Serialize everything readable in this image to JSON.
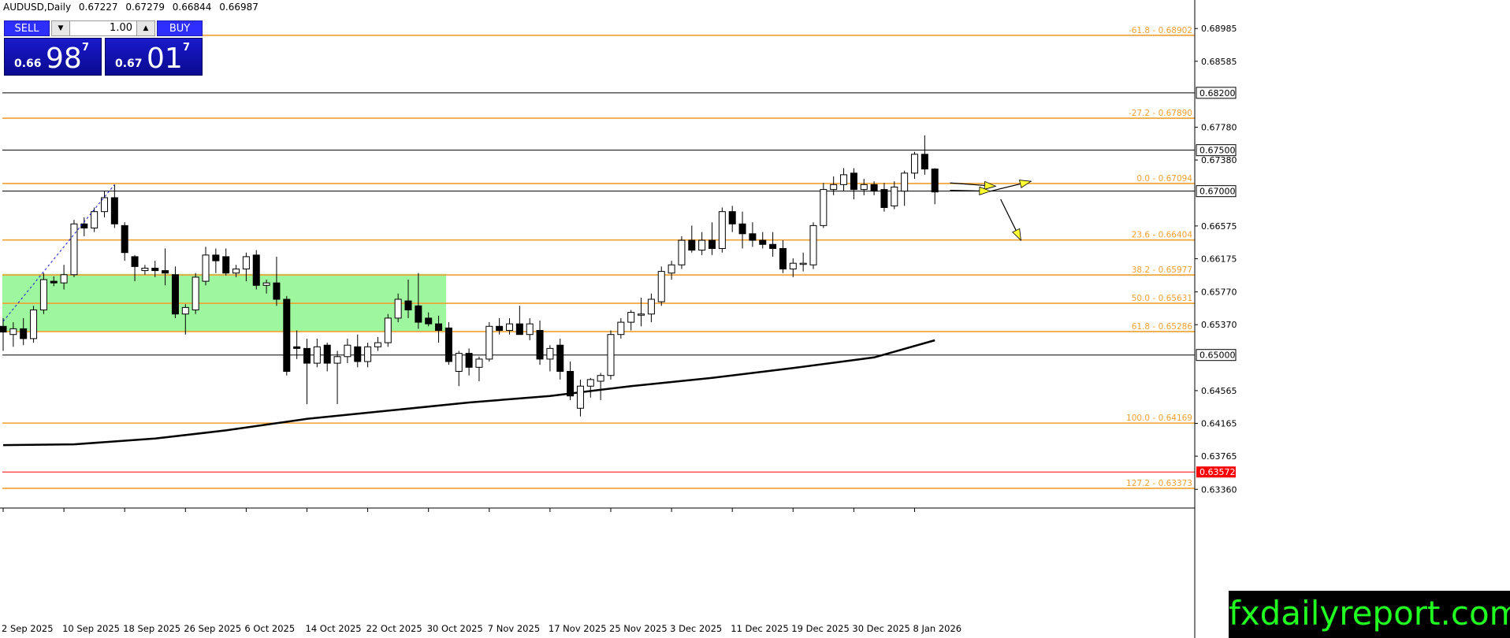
{
  "header": {
    "symbol": "AUDUSD,Daily",
    "open": "0.67227",
    "high": "0.67279",
    "low": "0.66844",
    "close": "0.66987"
  },
  "trade_panel": {
    "sell_label": "SELL",
    "buy_label": "BUY",
    "lot": "1.00",
    "sell_small": "0.66",
    "sell_big": "98",
    "sell_sup": "7",
    "buy_small": "0.67",
    "buy_big": "01",
    "buy_sup": "7"
  },
  "brand": "fxdailyreport.com",
  "colors": {
    "fib": "#f0a030",
    "zone": "#9ef79e",
    "ma": "#000000",
    "arrow": "#ffff33",
    "current_price_bg": "#ff0000",
    "brand_bg": "#000000",
    "brand_text": "#21ff21"
  },
  "chart_data": {
    "type": "candlestick",
    "symbol": "AUDUSD",
    "timeframe": "Daily",
    "x_tick_labels": [
      "2 Sep 2025",
      "10 Sep 2025",
      "18 Sep 2025",
      "26 Sep 2025",
      "6 Oct 2025",
      "14 Oct 2025",
      "22 Oct 2025",
      "30 Oct 2025",
      "7 Nov 2025",
      "17 Nov 2025",
      "25 Nov 2025",
      "3 Dec 2025",
      "11 Dec 2025",
      "19 Dec 2025",
      "30 Dec 2025",
      "8 Jan 2026"
    ],
    "y_tick_labels": [
      "0.68985",
      "0.68585",
      "0.67780",
      "0.67380",
      "0.66575",
      "0.66175",
      "0.65770",
      "0.65370",
      "0.64565",
      "0.64165",
      "0.63765",
      "0.63360"
    ],
    "ylim": [
      0.6318,
      0.6916
    ],
    "price_tags": [
      {
        "label": "0.68200",
        "value": 0.682
      },
      {
        "label": "0.67500",
        "value": 0.675
      },
      {
        "label": "0.67000",
        "value": 0.67
      },
      {
        "label": "0.65000",
        "value": 0.65
      }
    ],
    "current_price": {
      "label": "0.63572",
      "value": 0.63572
    },
    "horizontal_levels": [
      0.682,
      0.675,
      0.67,
      0.65
    ],
    "fib_levels": [
      {
        "label": "-61.8 - 0.68902",
        "value": 0.68902
      },
      {
        "label": "-27.2 - 0.67890",
        "value": 0.6789
      },
      {
        "label": "0.0 - 0.67094",
        "value": 0.67094
      },
      {
        "label": "23.6 - 0.66404",
        "value": 0.66404
      },
      {
        "label": "38.2 - 0.65977",
        "value": 0.65977
      },
      {
        "label": "50.0 - 0.65631",
        "value": 0.65631
      },
      {
        "label": "61.8 - 0.65286",
        "value": 0.65286
      },
      {
        "label": "100.0 - 0.64169",
        "value": 0.64169
      },
      {
        "label": "127.2 - 0.63373",
        "value": 0.63373
      }
    ],
    "support_zone": {
      "from": 0.6529,
      "to": 0.6599
    },
    "candles": [
      {
        "o": 0.6535,
        "h": 0.6545,
        "l": 0.6505,
        "c": 0.6528
      },
      {
        "o": 0.6525,
        "h": 0.654,
        "l": 0.651,
        "c": 0.6532
      },
      {
        "o": 0.6532,
        "h": 0.6545,
        "l": 0.6512,
        "c": 0.652
      },
      {
        "o": 0.652,
        "h": 0.656,
        "l": 0.6515,
        "c": 0.6555
      },
      {
        "o": 0.6555,
        "h": 0.66,
        "l": 0.655,
        "c": 0.6592
      },
      {
        "o": 0.659,
        "h": 0.6596,
        "l": 0.6584,
        "c": 0.6588
      },
      {
        "o": 0.6588,
        "h": 0.661,
        "l": 0.658,
        "c": 0.6598
      },
      {
        "o": 0.6598,
        "h": 0.6665,
        "l": 0.6595,
        "c": 0.666
      },
      {
        "o": 0.666,
        "h": 0.6668,
        "l": 0.6645,
        "c": 0.6655
      },
      {
        "o": 0.6655,
        "h": 0.668,
        "l": 0.665,
        "c": 0.6675
      },
      {
        "o": 0.6675,
        "h": 0.67,
        "l": 0.6668,
        "c": 0.6692
      },
      {
        "o": 0.6692,
        "h": 0.6708,
        "l": 0.6655,
        "c": 0.666
      },
      {
        "o": 0.6658,
        "h": 0.6662,
        "l": 0.6615,
        "c": 0.6625
      },
      {
        "o": 0.662,
        "h": 0.6622,
        "l": 0.659,
        "c": 0.6608
      },
      {
        "o": 0.6603,
        "h": 0.661,
        "l": 0.6598,
        "c": 0.6606
      },
      {
        "o": 0.6606,
        "h": 0.6615,
        "l": 0.6595,
        "c": 0.6603
      },
      {
        "o": 0.6603,
        "h": 0.663,
        "l": 0.6585,
        "c": 0.66
      },
      {
        "o": 0.6598,
        "h": 0.6608,
        "l": 0.6545,
        "c": 0.655
      },
      {
        "o": 0.655,
        "h": 0.6562,
        "l": 0.6525,
        "c": 0.6558
      },
      {
        "o": 0.6555,
        "h": 0.66,
        "l": 0.655,
        "c": 0.6595
      },
      {
        "o": 0.659,
        "h": 0.6632,
        "l": 0.6585,
        "c": 0.6622
      },
      {
        "o": 0.6622,
        "h": 0.663,
        "l": 0.66,
        "c": 0.6615
      },
      {
        "o": 0.662,
        "h": 0.663,
        "l": 0.6597,
        "c": 0.66
      },
      {
        "o": 0.66,
        "h": 0.661,
        "l": 0.6595,
        "c": 0.6605
      },
      {
        "o": 0.6605,
        "h": 0.6625,
        "l": 0.659,
        "c": 0.662
      },
      {
        "o": 0.6622,
        "h": 0.6628,
        "l": 0.658,
        "c": 0.6585
      },
      {
        "o": 0.6585,
        "h": 0.6592,
        "l": 0.6575,
        "c": 0.6588
      },
      {
        "o": 0.6588,
        "h": 0.662,
        "l": 0.656,
        "c": 0.6568
      },
      {
        "o": 0.6568,
        "h": 0.6572,
        "l": 0.6475,
        "c": 0.648
      },
      {
        "o": 0.651,
        "h": 0.653,
        "l": 0.6495,
        "c": 0.6508
      },
      {
        "o": 0.6508,
        "h": 0.652,
        "l": 0.644,
        "c": 0.649
      },
      {
        "o": 0.649,
        "h": 0.652,
        "l": 0.6485,
        "c": 0.651
      },
      {
        "o": 0.6512,
        "h": 0.6515,
        "l": 0.648,
        "c": 0.649
      },
      {
        "o": 0.649,
        "h": 0.6505,
        "l": 0.644,
        "c": 0.6498
      },
      {
        "o": 0.6498,
        "h": 0.652,
        "l": 0.649,
        "c": 0.6512
      },
      {
        "o": 0.651,
        "h": 0.6525,
        "l": 0.6485,
        "c": 0.6492
      },
      {
        "o": 0.6492,
        "h": 0.6515,
        "l": 0.6485,
        "c": 0.651
      },
      {
        "o": 0.651,
        "h": 0.6522,
        "l": 0.6505,
        "c": 0.6515
      },
      {
        "o": 0.6515,
        "h": 0.655,
        "l": 0.651,
        "c": 0.6545
      },
      {
        "o": 0.6545,
        "h": 0.6575,
        "l": 0.654,
        "c": 0.6568
      },
      {
        "o": 0.6566,
        "h": 0.6592,
        "l": 0.6545,
        "c": 0.6555
      },
      {
        "o": 0.656,
        "h": 0.66,
        "l": 0.6532,
        "c": 0.654
      },
      {
        "o": 0.6545,
        "h": 0.6552,
        "l": 0.6535,
        "c": 0.6538
      },
      {
        "o": 0.6538,
        "h": 0.6548,
        "l": 0.6515,
        "c": 0.653
      },
      {
        "o": 0.6533,
        "h": 0.654,
        "l": 0.6488,
        "c": 0.6492
      },
      {
        "o": 0.648,
        "h": 0.6505,
        "l": 0.6462,
        "c": 0.6502
      },
      {
        "o": 0.6502,
        "h": 0.6508,
        "l": 0.6475,
        "c": 0.6485
      },
      {
        "o": 0.6485,
        "h": 0.6498,
        "l": 0.6468,
        "c": 0.6495
      },
      {
        "o": 0.6495,
        "h": 0.654,
        "l": 0.6492,
        "c": 0.6535
      },
      {
        "o": 0.6535,
        "h": 0.6545,
        "l": 0.6525,
        "c": 0.653
      },
      {
        "o": 0.653,
        "h": 0.6545,
        "l": 0.6525,
        "c": 0.6538
      },
      {
        "o": 0.6538,
        "h": 0.656,
        "l": 0.653,
        "c": 0.6525
      },
      {
        "o": 0.6525,
        "h": 0.6545,
        "l": 0.6518,
        "c": 0.6538
      },
      {
        "o": 0.653,
        "h": 0.6542,
        "l": 0.6488,
        "c": 0.6495
      },
      {
        "o": 0.6495,
        "h": 0.6512,
        "l": 0.648,
        "c": 0.6508
      },
      {
        "o": 0.6512,
        "h": 0.652,
        "l": 0.647,
        "c": 0.648
      },
      {
        "o": 0.648,
        "h": 0.6492,
        "l": 0.6445,
        "c": 0.645
      },
      {
        "o": 0.6435,
        "h": 0.647,
        "l": 0.6425,
        "c": 0.6462
      },
      {
        "o": 0.6462,
        "h": 0.6472,
        "l": 0.6448,
        "c": 0.647
      },
      {
        "o": 0.6468,
        "h": 0.6478,
        "l": 0.6445,
        "c": 0.6475
      },
      {
        "o": 0.6475,
        "h": 0.653,
        "l": 0.647,
        "c": 0.6525
      },
      {
        "o": 0.6525,
        "h": 0.6545,
        "l": 0.652,
        "c": 0.654
      },
      {
        "o": 0.654,
        "h": 0.6555,
        "l": 0.653,
        "c": 0.6552
      },
      {
        "o": 0.655,
        "h": 0.657,
        "l": 0.6535,
        "c": 0.655
      },
      {
        "o": 0.655,
        "h": 0.6575,
        "l": 0.654,
        "c": 0.6568
      },
      {
        "o": 0.6565,
        "h": 0.6608,
        "l": 0.656,
        "c": 0.6602
      },
      {
        "o": 0.66,
        "h": 0.6615,
        "l": 0.6592,
        "c": 0.661
      },
      {
        "o": 0.661,
        "h": 0.6645,
        "l": 0.6605,
        "c": 0.664
      },
      {
        "o": 0.664,
        "h": 0.6658,
        "l": 0.6625,
        "c": 0.6628
      },
      {
        "o": 0.6628,
        "h": 0.665,
        "l": 0.6622,
        "c": 0.664
      },
      {
        "o": 0.664,
        "h": 0.6662,
        "l": 0.6622,
        "c": 0.663
      },
      {
        "o": 0.663,
        "h": 0.668,
        "l": 0.6625,
        "c": 0.6675
      },
      {
        "o": 0.6675,
        "h": 0.6682,
        "l": 0.665,
        "c": 0.666
      },
      {
        "o": 0.666,
        "h": 0.6675,
        "l": 0.663,
        "c": 0.6648
      },
      {
        "o": 0.6648,
        "h": 0.6662,
        "l": 0.6632,
        "c": 0.664
      },
      {
        "o": 0.664,
        "h": 0.665,
        "l": 0.663,
        "c": 0.6635
      },
      {
        "o": 0.6635,
        "h": 0.665,
        "l": 0.662,
        "c": 0.663
      },
      {
        "o": 0.663,
        "h": 0.664,
        "l": 0.66,
        "c": 0.6605
      },
      {
        "o": 0.6605,
        "h": 0.6618,
        "l": 0.6595,
        "c": 0.6612
      },
      {
        "o": 0.6612,
        "h": 0.6625,
        "l": 0.6602,
        "c": 0.6612
      },
      {
        "o": 0.661,
        "h": 0.6662,
        "l": 0.6605,
        "c": 0.6658
      },
      {
        "o": 0.6658,
        "h": 0.671,
        "l": 0.6655,
        "c": 0.6702
      },
      {
        "o": 0.6702,
        "h": 0.6718,
        "l": 0.6695,
        "c": 0.6708
      },
      {
        "o": 0.6708,
        "h": 0.6728,
        "l": 0.67,
        "c": 0.672
      },
      {
        "o": 0.6722,
        "h": 0.6728,
        "l": 0.669,
        "c": 0.6702
      },
      {
        "o": 0.6702,
        "h": 0.6715,
        "l": 0.6695,
        "c": 0.6708
      },
      {
        "o": 0.6708,
        "h": 0.6712,
        "l": 0.6695,
        "c": 0.67
      },
      {
        "o": 0.6702,
        "h": 0.671,
        "l": 0.6675,
        "c": 0.668
      },
      {
        "o": 0.6682,
        "h": 0.6712,
        "l": 0.6678,
        "c": 0.6705
      },
      {
        "o": 0.67,
        "h": 0.6725,
        "l": 0.6682,
        "c": 0.6722
      },
      {
        "o": 0.6722,
        "h": 0.6748,
        "l": 0.6715,
        "c": 0.6745
      },
      {
        "o": 0.6745,
        "h": 0.6768,
        "l": 0.672,
        "c": 0.6727
      },
      {
        "o": 0.6727,
        "h": 0.6728,
        "l": 0.6684,
        "c": 0.6699
      }
    ],
    "moving_average": [
      {
        "i": 0,
        "v": 0.639
      },
      {
        "i": 7,
        "v": 0.6391
      },
      {
        "i": 15,
        "v": 0.6398
      },
      {
        "i": 22,
        "v": 0.6408
      },
      {
        "i": 30,
        "v": 0.6422
      },
      {
        "i": 38,
        "v": 0.6432
      },
      {
        "i": 46,
        "v": 0.6442
      },
      {
        "i": 54,
        "v": 0.645
      },
      {
        "i": 62,
        "v": 0.6462
      },
      {
        "i": 70,
        "v": 0.6472
      },
      {
        "i": 78,
        "v": 0.6484
      },
      {
        "i": 86,
        "v": 0.6497
      },
      {
        "i": 92,
        "v": 0.6518
      }
    ],
    "fib_anchor_line": {
      "from": {
        "i": 0,
        "v": 0.6541
      },
      "to": {
        "i": 11,
        "v": 0.6708
      }
    },
    "arrows": [
      {
        "from": {
          "i": 93.5,
          "v": 0.671
        },
        "to": {
          "i": 98,
          "v": 0.6706
        }
      },
      {
        "from": {
          "i": 93.5,
          "v": 0.6701
        },
        "to": {
          "i": 97.5,
          "v": 0.67
        }
      },
      {
        "from": {
          "i": 97.5,
          "v": 0.67
        },
        "to": {
          "i": 101.5,
          "v": 0.6712
        }
      },
      {
        "from": {
          "i": 98.5,
          "v": 0.669
        },
        "to": {
          "i": 100.5,
          "v": 0.664
        }
      }
    ]
  }
}
